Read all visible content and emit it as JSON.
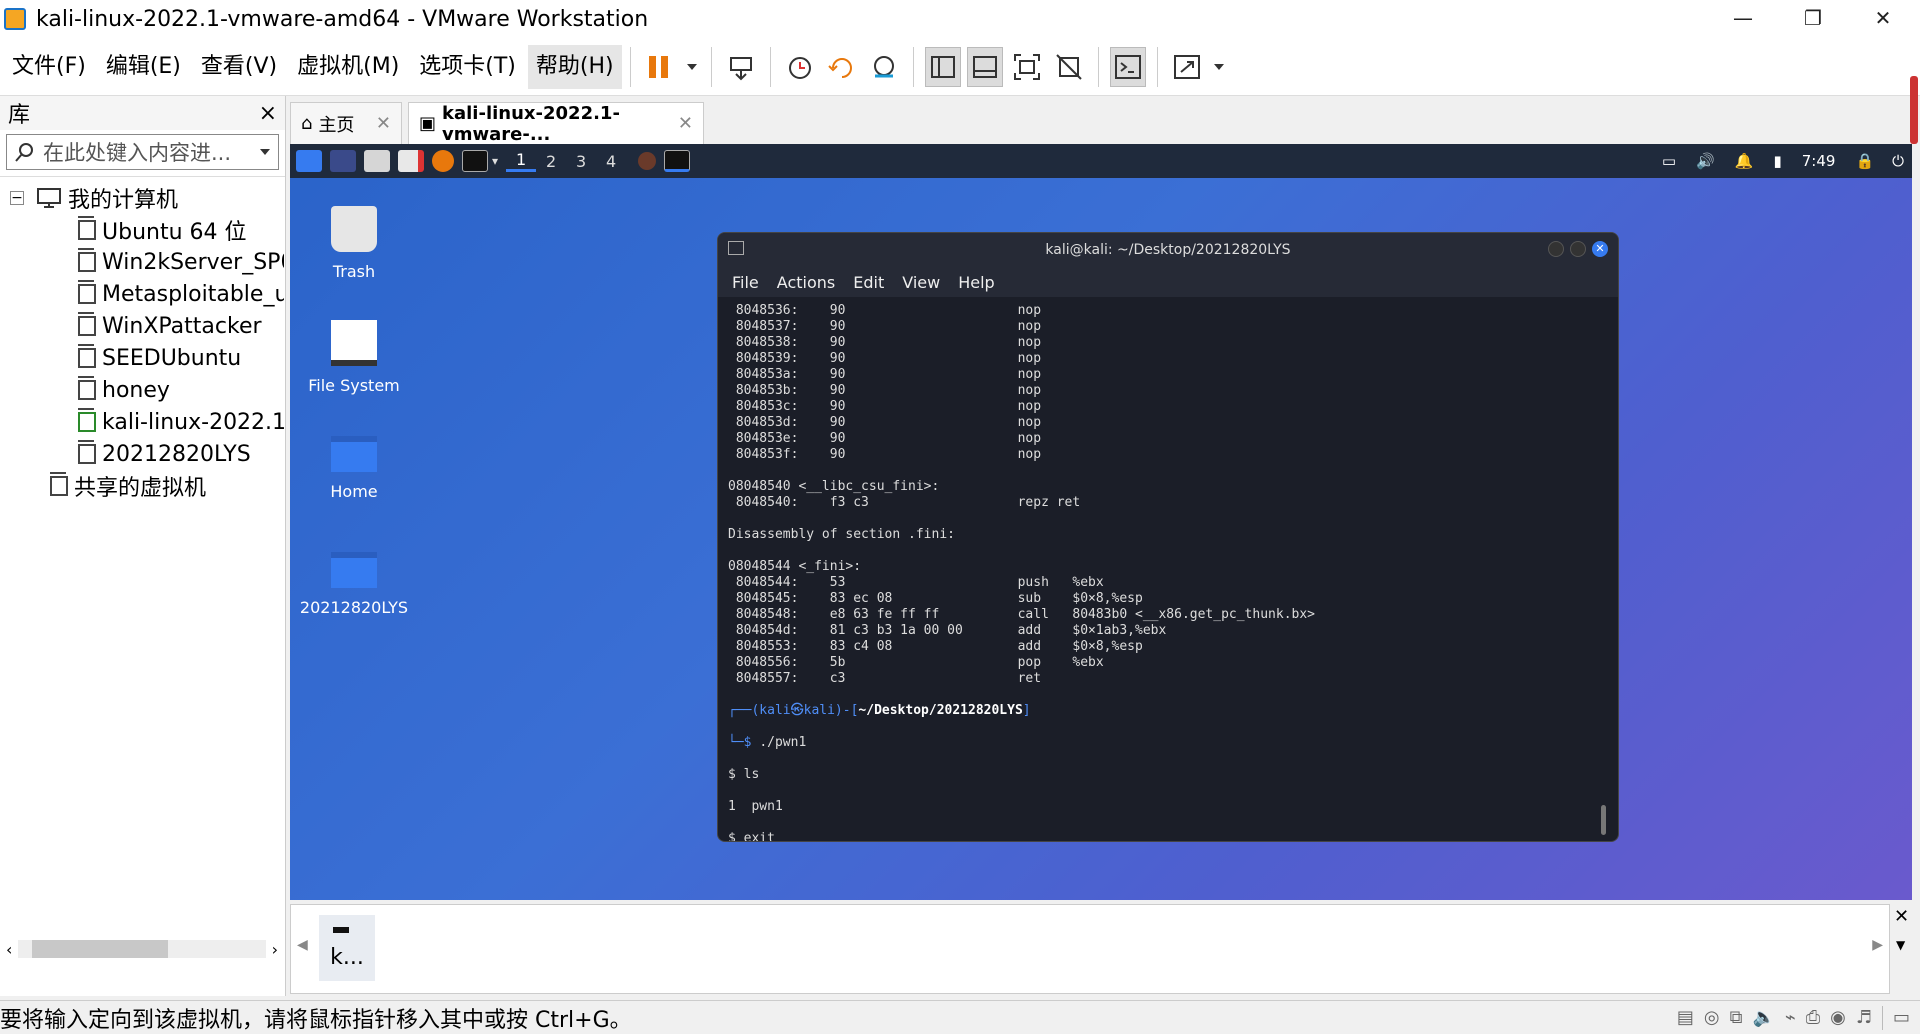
{
  "window": {
    "title": "kali-linux-2022.1-vmware-amd64 - VMware Workstation",
    "minimize": "—",
    "restore": "❐",
    "close": "✕"
  },
  "menu": {
    "items": [
      "文件(F)",
      "编辑(E)",
      "查看(V)",
      "虚拟机(M)",
      "选项卡(T)",
      "帮助(H)"
    ]
  },
  "library": {
    "title": "库",
    "close": "×",
    "search_placeholder": "在此处键入内容进...",
    "root": "我的计算机",
    "vms": [
      "Ubuntu 64 位",
      "Win2kServer_SP0",
      "Metasploitable_u",
      "WinXPattacker",
      "SEEDUbuntu",
      "honey",
      "kali-linux-2022.1",
      "20212820LYS"
    ],
    "shared": "共享的虚拟机"
  },
  "tabs": [
    {
      "label": "主页"
    },
    {
      "label": "kali-linux-2022.1-vmware-..."
    }
  ],
  "vm": {
    "workspaces": [
      "1",
      "2",
      "3",
      "4"
    ],
    "clock": "7:49",
    "desktop_icons": [
      "Trash",
      "File System",
      "Home",
      "20212820LYS"
    ]
  },
  "terminal": {
    "title": "kali@kali: ~/Desktop/20212820LYS",
    "menu": [
      "File",
      "Actions",
      "Edit",
      "View",
      "Help"
    ],
    "nop_lines": [
      {
        "addr": " 8048536:",
        "hex": "90",
        "ins": "nop",
        "op": ""
      },
      {
        "addr": " 8048537:",
        "hex": "90",
        "ins": "nop",
        "op": ""
      },
      {
        "addr": " 8048538:",
        "hex": "90",
        "ins": "nop",
        "op": ""
      },
      {
        "addr": " 8048539:",
        "hex": "90",
        "ins": "nop",
        "op": ""
      },
      {
        "addr": " 804853a:",
        "hex": "90",
        "ins": "nop",
        "op": ""
      },
      {
        "addr": " 804853b:",
        "hex": "90",
        "ins": "nop",
        "op": ""
      },
      {
        "addr": " 804853c:",
        "hex": "90",
        "ins": "nop",
        "op": ""
      },
      {
        "addr": " 804853d:",
        "hex": "90",
        "ins": "nop",
        "op": ""
      },
      {
        "addr": " 804853e:",
        "hex": "90",
        "ins": "nop",
        "op": ""
      },
      {
        "addr": " 804853f:",
        "hex": "90",
        "ins": "nop",
        "op": ""
      }
    ],
    "csu_label": "08048540 <__libc_csu_fini>:",
    "csu_line": {
      "addr": " 8048540:",
      "hex": "f3 c3",
      "ins": "repz ret",
      "op": ""
    },
    "fini_section": "Disassembly of section .fini:",
    "fini_label": "08048544 <_fini>:",
    "fini_lines": [
      {
        "addr": " 8048544:",
        "hex": "53",
        "ins": "push",
        "op": "%ebx"
      },
      {
        "addr": " 8048545:",
        "hex": "83 ec 08",
        "ins": "sub",
        "op": "$0×8,%esp"
      },
      {
        "addr": " 8048548:",
        "hex": "e8 63 fe ff ff",
        "ins": "call",
        "op": "80483b0 <__x86.get_pc_thunk.bx>"
      },
      {
        "addr": " 804854d:",
        "hex": "81 c3 b3 1a 00 00",
        "ins": "add",
        "op": "$0×1ab3,%ebx"
      },
      {
        "addr": " 8048553:",
        "hex": "83 c4 08",
        "ins": "add",
        "op": "$0×8,%esp"
      },
      {
        "addr": " 8048556:",
        "hex": "5b",
        "ins": "pop",
        "op": "%ebx"
      },
      {
        "addr": " 8048557:",
        "hex": "c3",
        "ins": "ret",
        "op": ""
      }
    ],
    "prompt_user": "(kali㉿kali)",
    "prompt_dir": "~/Desktop/20212820LYS",
    "cmd1": "./pwn1",
    "out": [
      "$ ls",
      "1  pwn1",
      "$ exit"
    ]
  },
  "thumb": {
    "label": "k..."
  },
  "status": {
    "text": "要将输入定向到该虚拟机，请将鼠标指针移入其中或按 Ctrl+G。"
  }
}
